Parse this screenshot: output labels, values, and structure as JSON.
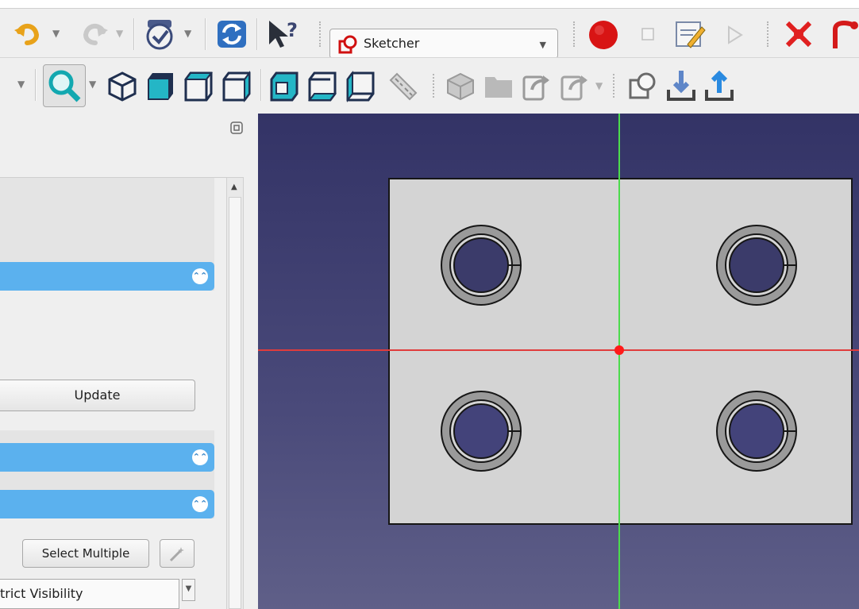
{
  "toolbar_top": {
    "undo_icon": "undo-icon",
    "redo_icon": "redo-icon",
    "validate_icon": "validate-icon",
    "refresh_icon": "refresh-icon",
    "whats_this_icon": "whats-this-icon",
    "workbench_selector": {
      "selected": "Sketcher",
      "icon": "sketcher-workbench-icon"
    },
    "macro_icons": [
      "record-macro-icon",
      "stop-macro-icon",
      "edit-macro-icon",
      "run-macro-icon"
    ],
    "sketch_icons": [
      "close-sketch-icon",
      "constrain-icon"
    ]
  },
  "toolbar_view": {
    "icons": [
      "zoom-fit-icon",
      "isometric-view-icon",
      "front-view-icon",
      "top-view-icon",
      "right-view-icon",
      "rear-view-icon",
      "bottom-view-icon",
      "left-view-icon",
      "measure-icon",
      "part-icon",
      "group-icon",
      "link-icon",
      "link-actions-icon",
      "sketch-view-icon",
      "import-icon",
      "export-icon"
    ]
  },
  "task_panel": {
    "update_button": "Update",
    "select_multiple_button": "Select Multiple",
    "visibility_combo": "trict Visibility"
  },
  "colors": {
    "panel_header": "#5bb1ee",
    "viewport_top": "#333366",
    "viewport_bottom": "#5f5f88",
    "x_axis": "#e03c3c",
    "y_axis": "#4cdc4c",
    "sketch_face": "#d4d4d4",
    "hole_ring": "#9a9a9a"
  }
}
